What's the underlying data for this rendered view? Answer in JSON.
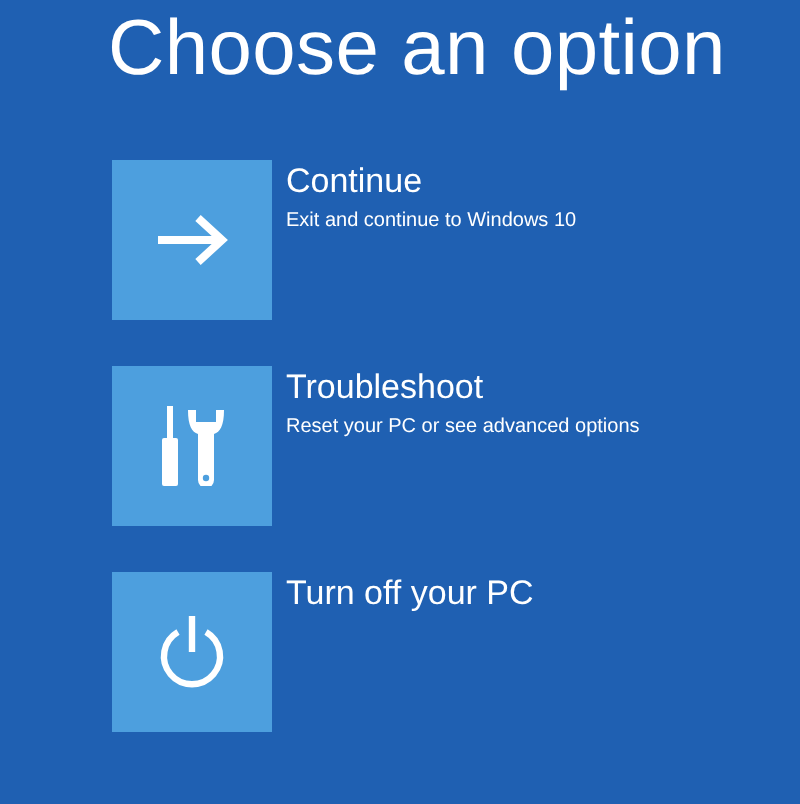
{
  "title": "Choose an option",
  "options": [
    {
      "kind": "arrow",
      "label": "Continue",
      "description": "Exit and continue to Windows 10"
    },
    {
      "kind": "tools",
      "label": "Troubleshoot",
      "description": "Reset your PC or see advanced options"
    },
    {
      "kind": "power",
      "label": "Turn off your PC"
    }
  ]
}
